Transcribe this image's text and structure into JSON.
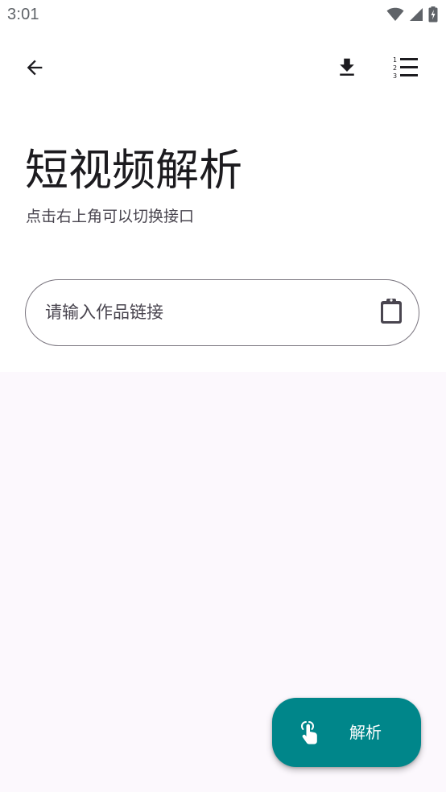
{
  "status_bar": {
    "time": "3:01",
    "icons": [
      "wifi-icon",
      "cellular-signal-icon",
      "battery-charging-icon"
    ]
  },
  "app_bar": {
    "back_icon": "arrow-back-icon",
    "actions": [
      "download-icon",
      "numbered-list-icon"
    ]
  },
  "header": {
    "title": "短视频解析",
    "subtitle": "点击右上角可以切换接口"
  },
  "link_input": {
    "value": "",
    "placeholder": "请输入作品链接",
    "trailing_icon": "clipboard-paste-icon"
  },
  "fab": {
    "label": "解析",
    "icon": "touch-gesture-icon"
  },
  "colors": {
    "accent": "#00868a",
    "background": "#ffffff",
    "content_background": "#fcf8fd",
    "outline": "#79747e",
    "text_primary": "#1c1b1f",
    "text_secondary": "#49454f"
  }
}
